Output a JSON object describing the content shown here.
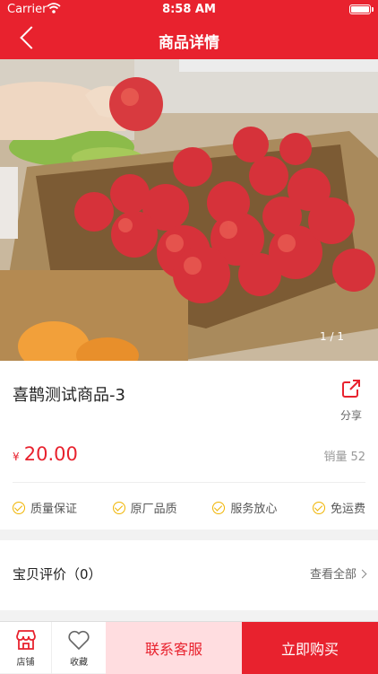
{
  "status_bar": {
    "carrier": "Carrier",
    "time": "8:58 AM"
  },
  "nav": {
    "title": "商品详情",
    "back_icon": "chevron-left-icon"
  },
  "gallery": {
    "counter": "1 / 1"
  },
  "product": {
    "title": "喜鹊测试商品-3",
    "share_label": "分享",
    "currency": "¥",
    "price": "20.00",
    "sales_label": "销量",
    "sales_count": "52"
  },
  "guarantees": [
    {
      "label": "质量保证"
    },
    {
      "label": "原厂品质"
    },
    {
      "label": "服务放心"
    },
    {
      "label": "免运费"
    }
  ],
  "reviews": {
    "title": "宝贝评价（0）",
    "view_all": "查看全部"
  },
  "bottom_bar": {
    "store_label": "店铺",
    "favorite_label": "收藏",
    "service_label": "联系客服",
    "buy_label": "立即购买"
  },
  "colors": {
    "brand": "#e8222e",
    "service_bg": "#ffdde0",
    "guarantee": "#f0b400"
  }
}
